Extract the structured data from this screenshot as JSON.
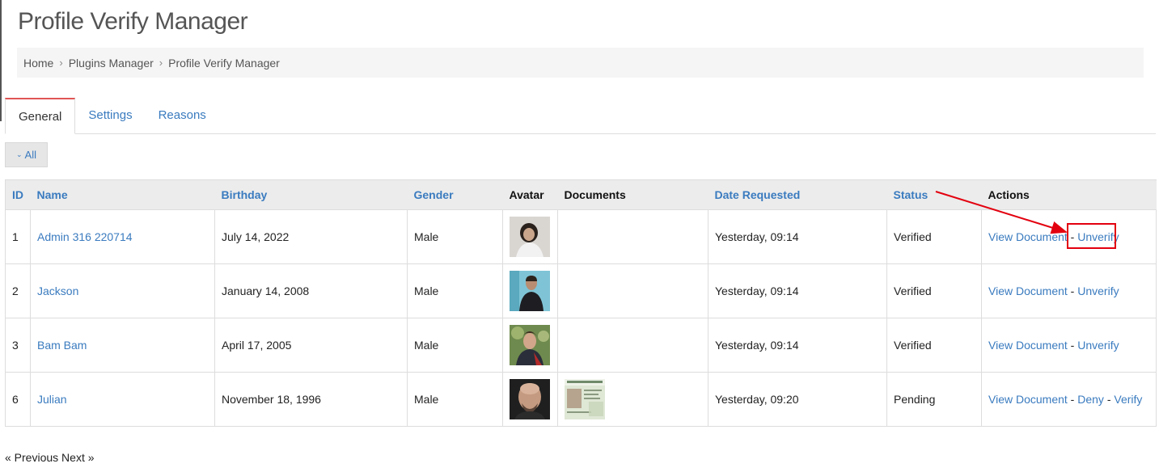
{
  "page": {
    "title": "Profile Verify Manager"
  },
  "breadcrumb": [
    "Home",
    "Plugins Manager",
    "Profile Verify Manager"
  ],
  "tabs": [
    {
      "label": "General",
      "active": true
    },
    {
      "label": "Settings",
      "active": false
    },
    {
      "label": "Reasons",
      "active": false
    }
  ],
  "filter": {
    "label": "All"
  },
  "table": {
    "headers": {
      "id": "ID",
      "name": "Name",
      "birthday": "Birthday",
      "gender": "Gender",
      "avatar": "Avatar",
      "documents": "Documents",
      "date_requested": "Date Requested",
      "status": "Status",
      "actions": "Actions"
    },
    "rows": [
      {
        "id": "1",
        "name": "Admin 316 220714",
        "birthday": "July 14, 2022",
        "gender": "Male",
        "date_requested": "Yesterday, 09:14",
        "status": "Verified",
        "action1": "View Document",
        "sep1": " - ",
        "action2": "Unverify"
      },
      {
        "id": "2",
        "name": "Jackson",
        "birthday": "January 14, 2008",
        "gender": "Male",
        "date_requested": "Yesterday, 09:14",
        "status": "Verified",
        "action1": "View Document",
        "sep1": " - ",
        "action2": "Unverify"
      },
      {
        "id": "3",
        "name": "Bam Bam",
        "birthday": "April 17, 2005",
        "gender": "Male",
        "date_requested": "Yesterday, 09:14",
        "status": "Verified",
        "action1": "View Document",
        "sep1": " - ",
        "action2": "Unverify"
      },
      {
        "id": "6",
        "name": "Julian",
        "birthday": "November 18, 1996",
        "gender": "Male",
        "date_requested": "Yesterday, 09:20",
        "status": "Pending",
        "action1": "View Document",
        "sep1": " - ",
        "action2": "Deny",
        "sep2": " - ",
        "action3": "Verify"
      }
    ]
  },
  "pager": {
    "prev": "« Previous",
    "next": "Next »"
  },
  "colors": {
    "link": "#3a7bbf",
    "active_tab_accent": "#e05555",
    "annotation": "#e3000f"
  }
}
